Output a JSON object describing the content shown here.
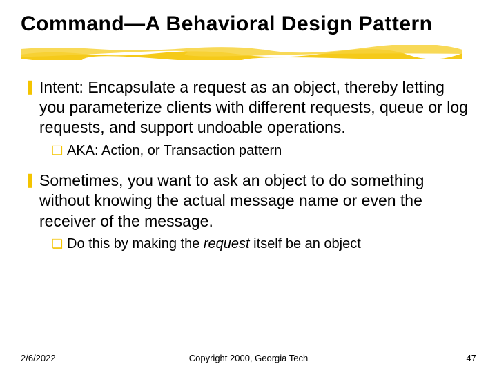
{
  "title": "Command—A Behavioral Design Pattern",
  "bullets": [
    {
      "text": "Intent: Encapsulate a request as an object, thereby letting you parameterize clients with different requests, queue or log requests, and support undoable operations.",
      "sub": {
        "plain": "AKA: Action, or Transaction pattern"
      }
    },
    {
      "text": "Sometimes, you want to ask an object to do something without knowing the actual message name or even the receiver of the message.",
      "sub": {
        "pre": "Do this by making the ",
        "italic": "request",
        "post": " itself be an object"
      }
    }
  ],
  "footer": {
    "date": "2/6/2022",
    "copyright": "Copyright 2000, Georgia Tech",
    "page": "47"
  }
}
